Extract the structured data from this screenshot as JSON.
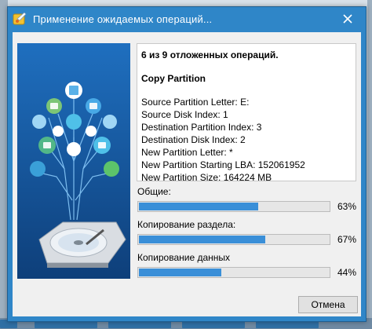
{
  "dialog": {
    "title": "Применение ожидаемых операций...",
    "close_icon": "close-icon",
    "app_icon": "app-logo-icon"
  },
  "info": {
    "heading": "6 из 9 отложенных операций.",
    "operation": "Copy Partition",
    "details": [
      "Source Partition Letter: E:",
      "Source Disk Index: 1",
      "Destination Partition Index: 3",
      "Destination Disk Index: 2",
      "New Partition Letter: *",
      "New Partition Starting LBA: 152061952",
      "New Partition Size: 164224 MB"
    ]
  },
  "progress": [
    {
      "label": "Общие:",
      "percent_text": "63%",
      "value": 0.63
    },
    {
      "label": "Копирование раздела:",
      "percent_text": "67%",
      "value": 0.67
    },
    {
      "label": "Копирование данных",
      "percent_text": "44%",
      "value": 0.44
    }
  ],
  "buttons": {
    "cancel": "Отмена"
  },
  "colors": {
    "titlebar": "#2f86c8",
    "progress_fill": "#3a8fd8"
  }
}
